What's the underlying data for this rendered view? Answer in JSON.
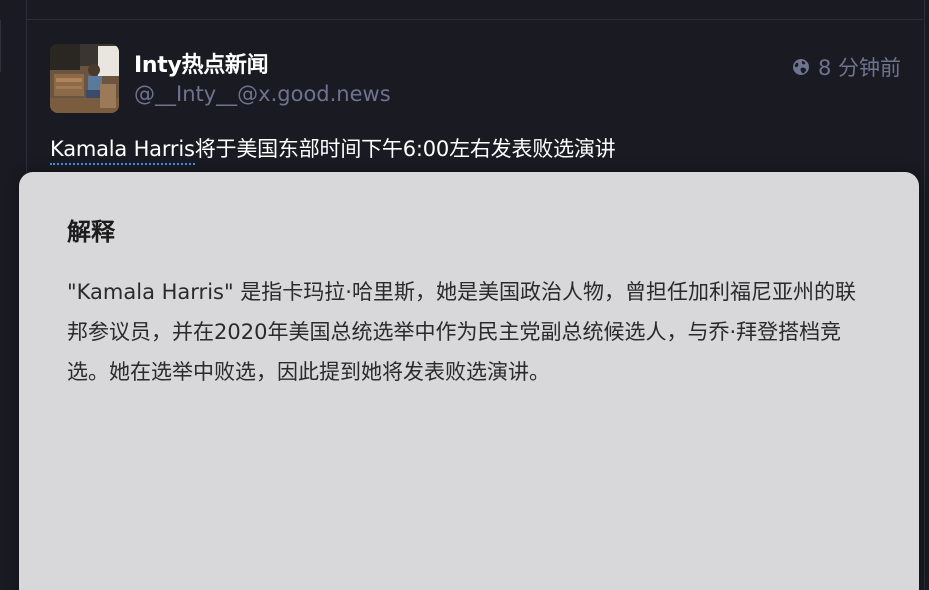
{
  "post": {
    "display_name": "Inty热点新闻",
    "handle": "@__Inty__@x.good.news",
    "visibility_icon": "globe-icon",
    "timestamp": "8 分钟前",
    "text_link": "Kamala Harris",
    "text_rest": "将于美国东部时间下午6:00左右发表败选演讲"
  },
  "explanation": {
    "title": "解释",
    "body": "\"Kamala Harris\" 是指卡玛拉·哈里斯，她是美国政治人物，曾担任加利福尼亚州的联邦参议员，并在2020年美国总统选举中作为民主党副总统候选人，与乔·拜登搭档竞选。她在选举中败选，因此提到她将发表败选演讲。"
  },
  "colors": {
    "background": "#1a1a22",
    "secondary_text": "#6e7390",
    "link_underline": "#3d8ef0",
    "panel_background": "#d8d8da"
  }
}
